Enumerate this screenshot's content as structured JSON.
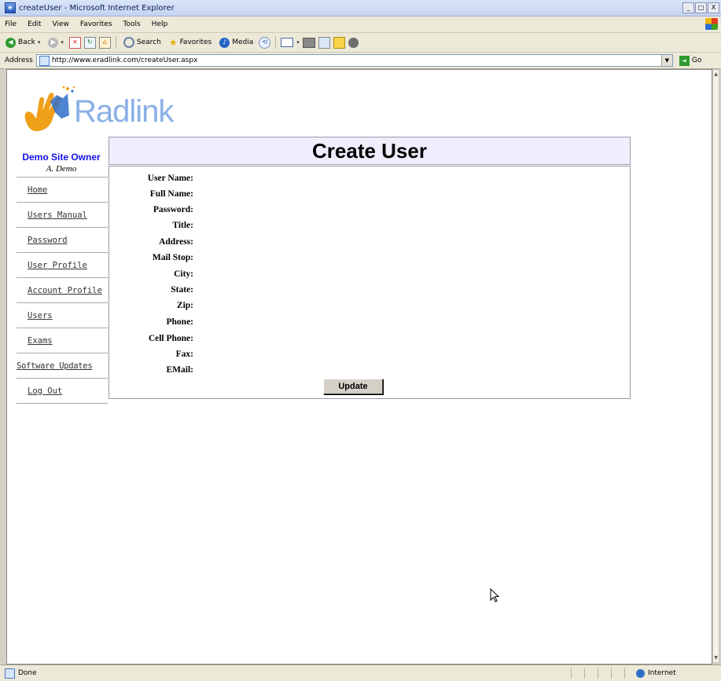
{
  "window": {
    "title": "createUser - Microsoft Internet Explorer",
    "controls": [
      "_",
      "□",
      "X"
    ]
  },
  "menu": [
    "File",
    "Edit",
    "View",
    "Favorites",
    "Tools",
    "Help"
  ],
  "toolbar": {
    "back_label": "Back",
    "search_label": "Search",
    "favorites_label": "Favorites",
    "media_label": "Media"
  },
  "address": {
    "label": "Address",
    "url": "http://www.eradlink.com/createUser.aspx",
    "go_label": "Go"
  },
  "logo": {
    "text": "Radlink"
  },
  "user": {
    "role": "Demo Site Owner",
    "name": "A. Demo"
  },
  "nav": [
    {
      "label": "Home"
    },
    {
      "label": "Users Manual"
    },
    {
      "label": "Password"
    },
    {
      "label": "User Profile"
    },
    {
      "label": "Account Profile"
    },
    {
      "label": "Users"
    },
    {
      "label": "Exams"
    },
    {
      "label": "Software Updates"
    },
    {
      "label": "Log Out"
    }
  ],
  "page": {
    "title": "Create User",
    "fields": [
      {
        "label": "User Name:"
      },
      {
        "label": "Full Name:"
      },
      {
        "label": "Password:"
      },
      {
        "label": "Title:"
      },
      {
        "label": "Address:"
      },
      {
        "label": "Mail Stop:"
      },
      {
        "label": "City:"
      },
      {
        "label": "State:"
      },
      {
        "label": "Zip:"
      },
      {
        "label": "Phone:"
      },
      {
        "label": "Cell Phone:"
      },
      {
        "label": "Fax:"
      },
      {
        "label": "EMail:"
      }
    ],
    "submit_label": "Update"
  },
  "status": {
    "text": "Done",
    "zone": "Internet"
  },
  "colors": {
    "role_text": "#1212e6",
    "header_bg": "#eeeefc",
    "logo_text": "#8ab0e6",
    "logo_hand": "#f0a018"
  },
  "icons": [
    "ie-page-icon",
    "windows-logo-icon",
    "back-icon",
    "forward-icon",
    "stop-icon",
    "refresh-icon",
    "home-icon",
    "search-icon",
    "favorites-star-icon",
    "media-icon",
    "history-icon",
    "mail-icon",
    "print-icon",
    "edit-icon",
    "messenger-icon",
    "go-icon",
    "globe-icon",
    "hand-logo-icon",
    "mouse-cursor-icon"
  ]
}
